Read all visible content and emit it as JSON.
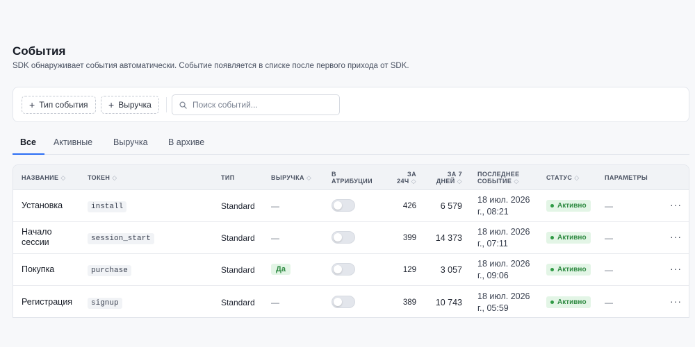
{
  "page": {
    "title": "События",
    "subtitle": "SDK обнаруживает события автоматически. Событие появляется в списке после первого прихода от SDK."
  },
  "toolbar": {
    "add_event_type": "Тип события",
    "add_revenue": "Выручка",
    "search_placeholder": "Поиск событий..."
  },
  "tabs": [
    {
      "label": "Все",
      "active": true
    },
    {
      "label": "Активные",
      "active": false
    },
    {
      "label": "Выручка",
      "active": false
    },
    {
      "label": "В архиве",
      "active": false
    }
  ],
  "table": {
    "headers": {
      "name": "НАЗВАНИЕ",
      "token": "ТОКЕН",
      "type": "ТИП",
      "revenue": "ВЫРУЧКА",
      "attribution_1": "В",
      "attribution_2": "АТРИБУЦИИ",
      "day_1": "ЗА",
      "day_2": "24Ч",
      "week_1": "ЗА 7",
      "week_2": "ДНЕЙ",
      "last_1": "ПОСЛЕДНЕЕ",
      "last_2": "СОБЫТИЕ",
      "status": "СТАТУС",
      "params": "ПАРАМЕТРЫ"
    },
    "rows": [
      {
        "name_1": "Установка",
        "name_2": "",
        "token": "install",
        "type": "Standard",
        "revenue": "—",
        "revenue_is_badge": false,
        "day": "426",
        "week": "6 579",
        "date_1": "18 июл. 2026",
        "date_2": "г., 08:21",
        "status": "Активно",
        "params": "—",
        "more": "···"
      },
      {
        "name_1": "Начало",
        "name_2": "сессии",
        "token": "session_start",
        "type": "Standard",
        "revenue": "—",
        "revenue_is_badge": false,
        "day": "399",
        "week": "14 373",
        "date_1": "18 июл. 2026",
        "date_2": "г., 07:11",
        "status": "Активно",
        "params": "—",
        "more": "···"
      },
      {
        "name_1": "Покупка",
        "name_2": "",
        "token": "purchase",
        "type": "Standard",
        "revenue": "Да",
        "revenue_is_badge": true,
        "day": "129",
        "week": "3 057",
        "date_1": "18 июл. 2026",
        "date_2": "г., 09:06",
        "status": "Активно",
        "params": "—",
        "more": "···"
      },
      {
        "name_1": "Регистрация",
        "name_2": "",
        "token": "signup",
        "type": "Standard",
        "revenue": "—",
        "revenue_is_badge": false,
        "day": "389",
        "week": "10 743",
        "date_1": "18 июл. 2026",
        "date_2": "г., 05:59",
        "status": "Активно",
        "params": "—",
        "more": "···"
      }
    ]
  }
}
